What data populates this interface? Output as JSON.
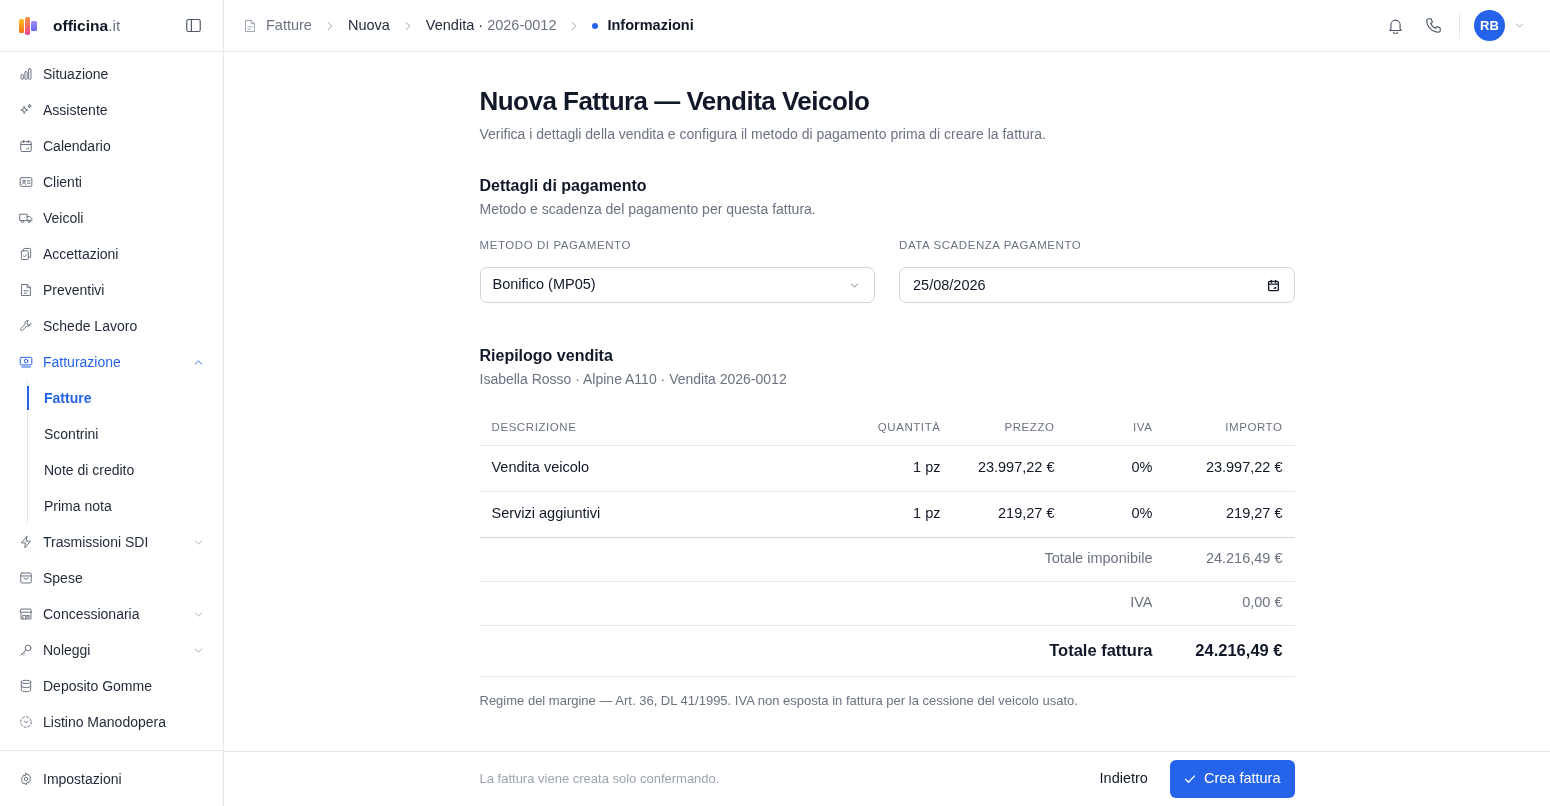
{
  "sidebar": {
    "brand": {
      "name": "officina",
      "suffix": ".it"
    },
    "items": [
      {
        "label": "Situazione",
        "selected": false
      },
      {
        "label": "Assistente",
        "selected": false
      },
      {
        "label": "Calendario",
        "selected": false
      },
      {
        "label": "Clienti",
        "selected": false
      },
      {
        "label": "Veicoli",
        "selected": false
      },
      {
        "label": "Accettazioni",
        "selected": false
      },
      {
        "label": "Preventivi",
        "selected": false
      },
      {
        "label": "Schede Lavoro",
        "selected": false
      },
      {
        "label": "Fatturazione",
        "selected": true,
        "expanded": true,
        "children": [
          {
            "label": "Fatture",
            "selected": true
          },
          {
            "label": "Scontrini",
            "selected": false
          },
          {
            "label": "Note di credito",
            "selected": false
          },
          {
            "label": "Prima nota",
            "selected": false
          }
        ]
      },
      {
        "label": "Trasmissioni SDI",
        "selected": false,
        "expanded": false
      },
      {
        "label": "Spese",
        "selected": false
      },
      {
        "label": "Concessionaria",
        "selected": false,
        "expanded": false
      },
      {
        "label": "Noleggi",
        "selected": false,
        "expanded": false
      },
      {
        "label": "Deposito Gomme",
        "selected": false
      },
      {
        "label": "Listino Manodopera",
        "selected": false
      }
    ],
    "footer_items": [
      {
        "label": "Impostazioni",
        "selected": false
      }
    ]
  },
  "topbar": {
    "breadcrumb": [
      {
        "label": "Fatture",
        "kind": "root"
      },
      {
        "label": "Nuova",
        "kind": "step"
      },
      {
        "label": "Vendita ·",
        "detail": "2026-0012",
        "kind": "step"
      },
      {
        "label": "Informazioni",
        "kind": "current"
      }
    ],
    "user": {
      "initials": "RB"
    }
  },
  "page": {
    "title": "Nuova Fattura — Vendita Veicolo",
    "subtitle": "Verifica i dettagli della vendita e configura il metodo di pagamento prima di creare la fattura."
  },
  "payment": {
    "title": "Dettagli di pagamento",
    "subtitle": "Metodo e scadenza del pagamento per questa fattura.",
    "method": {
      "label": "METODO DI PAGAMENTO",
      "value": "Bonifico (MP05)"
    },
    "due_date": {
      "label": "DATA SCADENZA PAGAMENTO",
      "value": "25/08/2026"
    }
  },
  "summary": {
    "title": "Riepilogo vendita",
    "subtitle": "Isabella Rosso · Alpine A110 · Vendita 2026-0012",
    "table": {
      "columns": [
        "DESCRIZIONE",
        "QUANTITÀ",
        "PREZZO",
        "IVA",
        "IMPORTO"
      ],
      "rows": [
        [
          "Vendita veicolo",
          "1 pz",
          "23.997,22 €",
          "0%",
          "23.997,22 €"
        ],
        [
          "Servizi aggiuntivi",
          "1 pz",
          "219,27 €",
          "0%",
          "219,27 €"
        ]
      ],
      "totals": [
        {
          "label": "Totale imponibile",
          "value": "24.216,49 €",
          "kind": "subtotal"
        },
        {
          "label": "IVA",
          "value": "0,00 €",
          "kind": "subtotal"
        },
        {
          "label": "Totale fattura",
          "value": "24.216,49 €",
          "kind": "grand"
        }
      ]
    },
    "note": "Regime del margine — Art. 36, DL 41/1995. IVA non esposta in fattura per la cessione del veicolo usato."
  },
  "footer": {
    "hint": "La fattura viene creata solo confermando.",
    "buttons": [
      {
        "label": "Indietro",
        "kind": "secondary"
      },
      {
        "label": "Crea fattura",
        "kind": "primary"
      }
    ]
  }
}
